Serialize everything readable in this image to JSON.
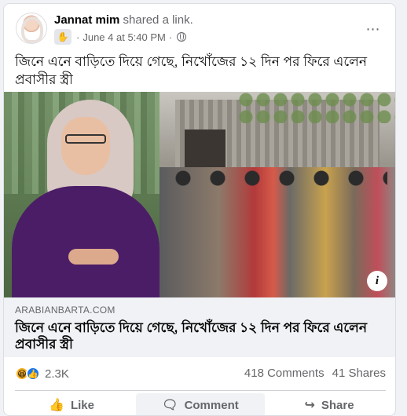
{
  "post": {
    "author": "Jannat mim",
    "action_text": "shared a link.",
    "date": "June 4 at 5:40 PM",
    "date_separator": "·",
    "more_icon": "⋯",
    "text": "জিনে এনে বাড়িতে দিয়ে গেছে, নিখোঁজের ১২ দিন পর ফিরে এলেন প্রবাসীর স্ত্রী"
  },
  "link": {
    "domain": "ARABIANBARTA.COM",
    "title": "জিনে এনে বাড়িতে দিয়ে গেছে, নিখোঁজের ১২ দিন পর ফিরে এলেন প্রবাসীর স্ত্রী",
    "info_icon": "i"
  },
  "stats": {
    "reaction_count": "2.3K",
    "comments": "418 Comments",
    "shares": "41 Shares"
  },
  "actions": {
    "like": "Like",
    "comment": "Comment",
    "share": "Share"
  },
  "icons": {
    "wave": "✋",
    "haha": "😆",
    "like_reaction": "👍",
    "like": "👍",
    "comment": "🗨",
    "share": "↪"
  }
}
